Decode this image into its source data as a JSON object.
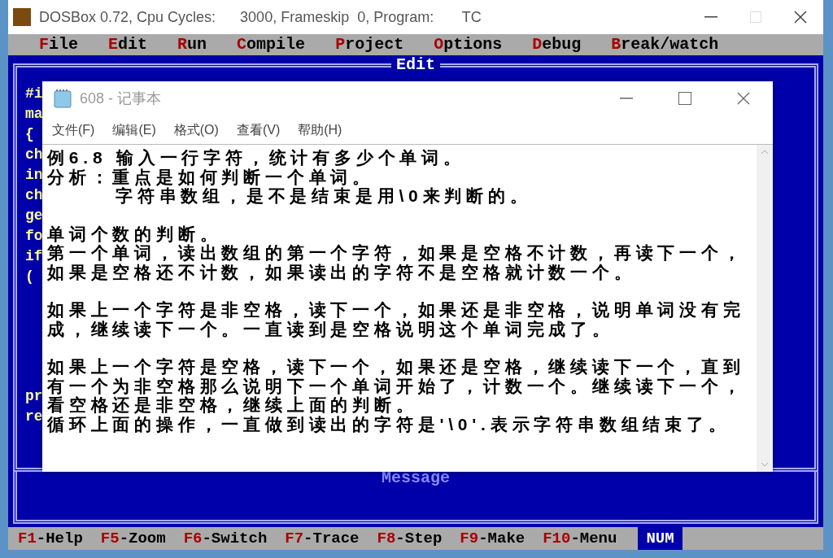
{
  "dosbox": {
    "title": "DOSBox 0.72, Cpu Cycles:      3000, Frameskip  0, Program:       TC",
    "maximize_disabled": true
  },
  "menu": [
    {
      "label": "File"
    },
    {
      "label": "Edit"
    },
    {
      "label": "Run"
    },
    {
      "label": "Compile"
    },
    {
      "label": "Project"
    },
    {
      "label": "Options"
    },
    {
      "label": "Debug"
    },
    {
      "label": "Break/watch"
    }
  ],
  "editor": {
    "title": "Edit",
    "code_lines_top": [
      "#i",
      "ma",
      "{",
      "ch",
      "in",
      "ch",
      "ge",
      "fo",
      "if",
      "("
    ],
    "code_lines_bottom": [
      "pr",
      "re"
    ]
  },
  "message": {
    "title": "Message"
  },
  "notepad": {
    "title": "608 - 记事本",
    "active": false,
    "menu": [
      "文件(F)",
      "编辑(E)",
      "格式(O)",
      "查看(V)",
      "帮助(H)"
    ],
    "paragraphs": [
      {
        "lines": [
          {
            "text": "例6.8 输入一行字符，统计有多少个单词。",
            "indent": false
          },
          {
            "text": "分析：重点是如何判断一个单词。",
            "indent": false
          },
          {
            "text": "字符串数组，是不是结束是用\\0来判断的。",
            "indent": true
          }
        ]
      },
      {
        "lines": [
          {
            "text": "单词个数的判断。",
            "indent": false
          },
          {
            "text": "第一个单词，读出数组的第一个字符，如果是空格不计数，再读下一个，",
            "indent": false
          },
          {
            "text": "如果是空格还不计数，如果读出的字符不是空格就计数一个。",
            "indent": false
          }
        ]
      },
      {
        "lines": [
          {
            "text": "如果上一个字符是非空格，读下一个，如果还是非空格，说明单词没有完",
            "indent": false
          },
          {
            "text": "成，继续读下一个。一直读到是空格说明这个单词完成了。",
            "indent": false
          }
        ]
      },
      {
        "lines": [
          {
            "text": "如果上一个字符是空格，读下一个，如果还是空格，继续读下一个，直到",
            "indent": false
          },
          {
            "text": "有一个为非空格那么说明下一个单词开始了，计数一个。继续读下一个，",
            "indent": false
          },
          {
            "text": "看空格还是非空格，继续上面的判断。",
            "indent": false
          },
          {
            "text": "循环上面的操作，一直做到读出的字符是'\\0'.表示字符串数组结束了。",
            "indent": false
          }
        ]
      }
    ]
  },
  "function_keys": [
    {
      "key": "F1",
      "action": "-Help"
    },
    {
      "key": "F5",
      "action": "-Zoom"
    },
    {
      "key": "F6",
      "action": "-Switch"
    },
    {
      "key": "F7",
      "action": "-Trace"
    },
    {
      "key": "F8",
      "action": "-Step"
    },
    {
      "key": "F9",
      "action": "-Make"
    },
    {
      "key": "F10",
      "action": "-Menu"
    }
  ],
  "num_lock": {
    "label": "NUM",
    "on": true
  }
}
